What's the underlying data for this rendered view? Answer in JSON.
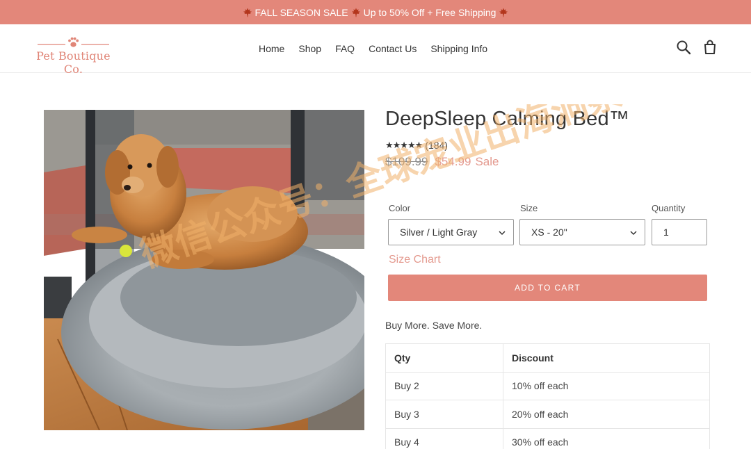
{
  "announcement": {
    "text": "FALL SEASON SALE",
    "offer": "Up to 50% Off + Free Shipping",
    "icon": "maple-leaf-icon"
  },
  "logo": {
    "text": "Pet Boutique Co.",
    "icon": "paw-icon",
    "color": "#e08577"
  },
  "nav": [
    "Home",
    "Shop",
    "FAQ",
    "Contact Us",
    "Shipping Info"
  ],
  "header_icons": [
    "search-icon",
    "cart-icon"
  ],
  "product": {
    "title": "DeepSleep Calming Bed™",
    "rating_stars": 5,
    "review_count": "(184)",
    "original_price": "$109.99",
    "sale_price": "$54.99",
    "sale_label": "Sale"
  },
  "options": {
    "color": {
      "label": "Color",
      "value": "Silver / Light Gray"
    },
    "size": {
      "label": "Size",
      "value": "XS - 20\""
    },
    "quantity": {
      "label": "Quantity",
      "value": "1"
    }
  },
  "size_chart_link": "Size Chart",
  "add_to_cart": "ADD TO CART",
  "promo_title": "Buy More. Save More.",
  "discount_table": {
    "headers": [
      "Qty",
      "Discount"
    ],
    "rows": [
      [
        "Buy 2",
        "10% off each"
      ],
      [
        "Buy 3",
        "20% off each"
      ],
      [
        "Buy 4",
        "30% off each"
      ]
    ]
  },
  "watermark": "微信公众号：全球宠业出海洞察",
  "colors": {
    "accent": "#e3877a",
    "sale": "#e49a8f",
    "text": "#333333"
  }
}
